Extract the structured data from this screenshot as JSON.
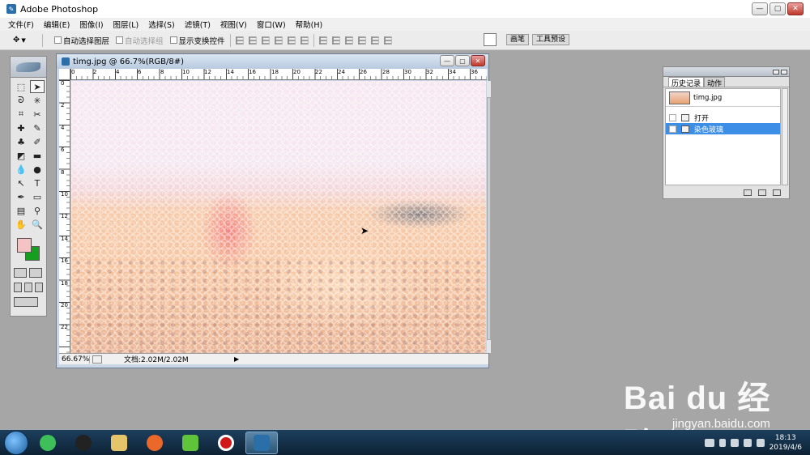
{
  "app": {
    "title": "Adobe Photoshop"
  },
  "menu": [
    "文件(F)",
    "编辑(E)",
    "图像(I)",
    "图层(L)",
    "选择(S)",
    "滤镜(T)",
    "视图(V)",
    "窗口(W)",
    "帮助(H)"
  ],
  "options": {
    "auto_select_layer": "自动选择图层",
    "auto_select_group": "自动选择组",
    "show_transform": "显示变换控件"
  },
  "palette_well": {
    "tabs": [
      "画笔",
      "工具预设"
    ]
  },
  "document": {
    "title": "timg.jpg @ 66.7%(RGB/8#)",
    "zoom": "66.67%",
    "doc_info": "文档:2.02M/2.02M",
    "ruler_h_labels": [
      "0",
      "2",
      "4",
      "6",
      "8",
      "10",
      "12",
      "14",
      "16",
      "18",
      "20",
      "22",
      "24",
      "26",
      "28",
      "30",
      "32",
      "34",
      "36"
    ],
    "ruler_v_labels": [
      "0",
      "2",
      "4",
      "6",
      "8",
      "10",
      "12",
      "14",
      "16",
      "18",
      "20",
      "22"
    ]
  },
  "history_panel": {
    "tabs": [
      "历史记录",
      "动作"
    ],
    "snapshot": "timg.jpg",
    "states": [
      {
        "label": "打开",
        "selected": false
      },
      {
        "label": "染色玻璃",
        "selected": true
      }
    ]
  },
  "taskbar": {
    "time": "18:13",
    "date": "2019/4/6"
  },
  "watermark": {
    "brand": "Bai du 经验",
    "url": "jingyan.baidu.com"
  },
  "colors": {
    "foreground": "#f5c3c3",
    "background": "#14a01e",
    "selection": "#3d8ee6"
  }
}
